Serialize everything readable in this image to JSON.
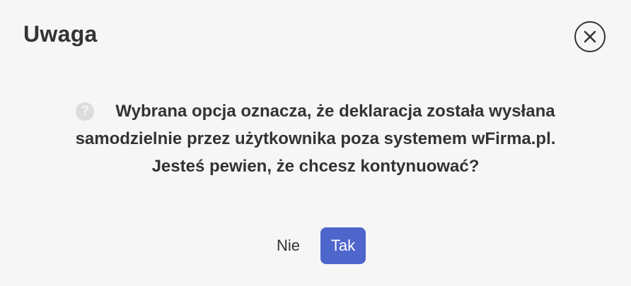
{
  "dialog": {
    "title": "Uwaga",
    "close_icon": "close-icon",
    "help_icon": "question-icon",
    "help_icon_glyph": "?",
    "message_line1": "Wybrana opcja oznacza, że deklaracja została wysłana",
    "message_line2": "samodzielnie przez użytkownika poza systemem wFirma.pl.",
    "message_line3": "Jesteś pewien, że chcesz kontynuować?",
    "no_label": "Nie",
    "yes_label": "Tak"
  },
  "colors": {
    "background": "#f6f6f6",
    "text": "#333333",
    "primary_button": "#4e66cc",
    "help_icon": "#dcdcdc"
  }
}
